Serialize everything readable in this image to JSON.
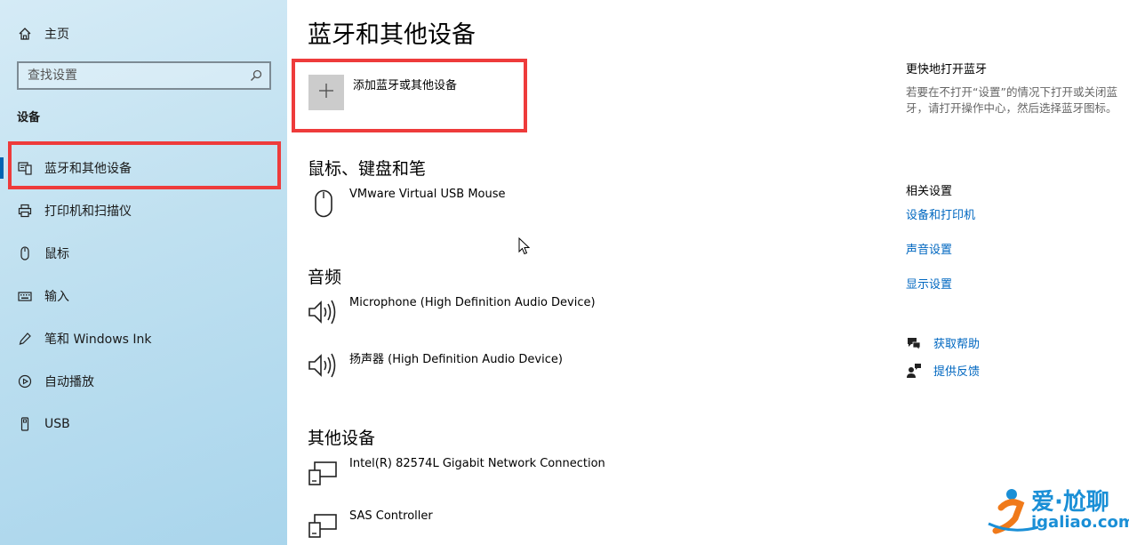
{
  "sidebar": {
    "home_label": "主页",
    "search_placeholder": "查找设置",
    "section_label": "设备",
    "items": [
      {
        "label": "蓝牙和其他设备",
        "icon": "bluetooth-devices-icon"
      },
      {
        "label": "打印机和扫描仪",
        "icon": "printer-icon"
      },
      {
        "label": "鼠标",
        "icon": "mouse-icon"
      },
      {
        "label": "输入",
        "icon": "keyboard-icon"
      },
      {
        "label": "笔和 Windows Ink",
        "icon": "pen-icon"
      },
      {
        "label": "自动播放",
        "icon": "autoplay-icon"
      },
      {
        "label": "USB",
        "icon": "usb-icon"
      }
    ]
  },
  "main": {
    "title": "蓝牙和其他设备",
    "add_device_label": "添加蓝牙或其他设备",
    "groups": [
      {
        "title": "鼠标、键盘和笔",
        "devices": [
          {
            "name": "VMware Virtual USB Mouse",
            "icon": "mouse-icon"
          }
        ]
      },
      {
        "title": "音频",
        "devices": [
          {
            "name": "Microphone (High Definition Audio Device)",
            "icon": "speaker-icon"
          },
          {
            "name": "扬声器 (High Definition Audio Device)",
            "icon": "speaker-icon"
          }
        ]
      },
      {
        "title": "其他设备",
        "devices": [
          {
            "name": "Intel(R) 82574L Gigabit Network Connection",
            "icon": "device-icon"
          },
          {
            "name": "SAS Controller",
            "icon": "device-icon"
          }
        ]
      }
    ]
  },
  "right_pane": {
    "quick_title": "更快地打开蓝牙",
    "quick_desc": "若要在不打开“设置”的情况下打开或关闭蓝牙，请打开操作中心，然后选择蓝牙图标。",
    "related_title": "相关设置",
    "related_links": [
      "设备和打印机",
      "声音设置",
      "显示设置"
    ],
    "help_label": "获取帮助",
    "feedback_label": "提供反馈"
  },
  "watermark": {
    "text": "爱·尬聊",
    "sub": "igaliao.com"
  },
  "colors": {
    "accent": "#0063b1",
    "link": "#0067c0",
    "highlight_box": "#ee3b3b",
    "sidebar_bg": "#bfe0f0",
    "add_tile": "#cccccc"
  }
}
